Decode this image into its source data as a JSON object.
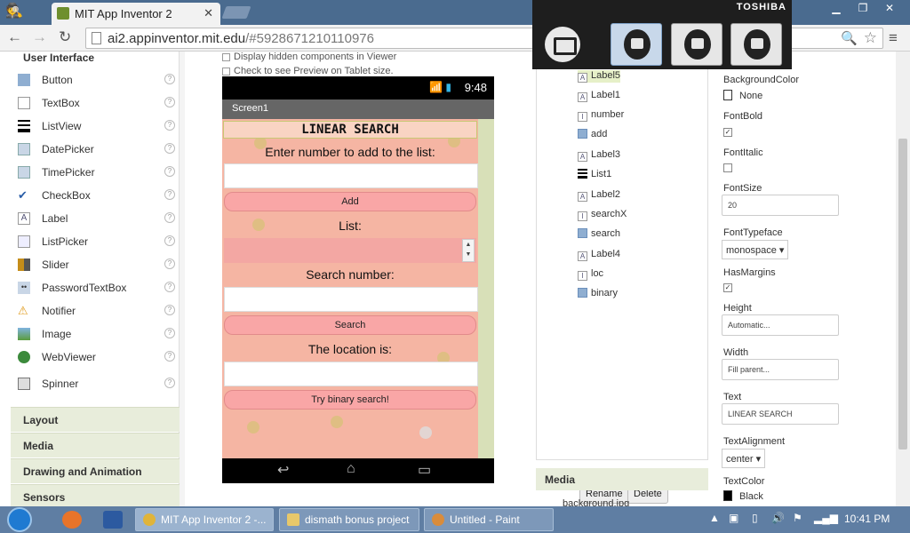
{
  "browser": {
    "tab_title": "MIT App Inventor 2",
    "url_host": "ai2.appinventor.mit.edu",
    "url_path": "/#5928671210110976"
  },
  "toshiba": {
    "brand": "TOSHIBA"
  },
  "palette": {
    "header": "User Interface",
    "items": [
      {
        "label": "Button",
        "icon": "button-icon"
      },
      {
        "label": "TextBox",
        "icon": "textbox-icon"
      },
      {
        "label": "ListView",
        "icon": "listview-icon"
      },
      {
        "label": "DatePicker",
        "icon": "datepicker-icon"
      },
      {
        "label": "TimePicker",
        "icon": "timepicker-icon"
      },
      {
        "label": "CheckBox",
        "icon": "checkbox-icon"
      },
      {
        "label": "Label",
        "icon": "label-icon"
      },
      {
        "label": "ListPicker",
        "icon": "listpicker-icon"
      },
      {
        "label": "Slider",
        "icon": "slider-icon"
      },
      {
        "label": "PasswordTextBox",
        "icon": "passwordtextbox-icon"
      },
      {
        "label": "Notifier",
        "icon": "notifier-icon"
      },
      {
        "label": "Image",
        "icon": "image-icon"
      },
      {
        "label": "WebViewer",
        "icon": "webviewer-icon"
      },
      {
        "label": "Spinner",
        "icon": "spinner-icon"
      }
    ],
    "drawers": [
      "Layout",
      "Media",
      "Drawing and Animation",
      "Sensors"
    ]
  },
  "viewer": {
    "check_hidden": "Display hidden components in Viewer",
    "check_tablet": "Check to see Preview on Tablet size.",
    "status_time": "9:48",
    "screen_title": "Screen1",
    "heading": "LINEAR SEARCH",
    "label_enter": "Enter number to add to the list:",
    "btn_add": "Add",
    "label_list": "List:",
    "label_search": "Search number:",
    "btn_search": "Search",
    "label_location": "The location is:",
    "btn_binary": "Try binary search!"
  },
  "components": {
    "items": [
      {
        "label": "Label5",
        "icon": "label-icon"
      },
      {
        "label": "Label1",
        "icon": "label-icon"
      },
      {
        "label": "number",
        "icon": "textbox-icon"
      },
      {
        "label": "add",
        "icon": "button-icon"
      },
      {
        "label": "Label3",
        "icon": "label-icon"
      },
      {
        "label": "List1",
        "icon": "listview-icon"
      },
      {
        "label": "Label2",
        "icon": "label-icon"
      },
      {
        "label": "searchX",
        "icon": "textbox-icon"
      },
      {
        "label": "search",
        "icon": "button-icon"
      },
      {
        "label": "Label4",
        "icon": "label-icon"
      },
      {
        "label": "loc",
        "icon": "textbox-icon"
      },
      {
        "label": "binary",
        "icon": "button-icon"
      }
    ],
    "rename": "Rename",
    "delete": "Delete",
    "media_header": "Media",
    "media_item": "background.jpg"
  },
  "properties": {
    "bgcolor_label": "BackgroundColor",
    "bgcolor_value": "None",
    "fontbold_label": "FontBold",
    "fontitalic_label": "FontItalic",
    "fontsize_label": "FontSize",
    "fontsize_value": "20",
    "fonttypeface_label": "FontTypeface",
    "fonttypeface_value": "monospace",
    "hasmargins_label": "HasMargins",
    "height_label": "Height",
    "height_value": "Automatic...",
    "width_label": "Width",
    "width_value": "Fill parent...",
    "text_label": "Text",
    "text_value": "LINEAR SEARCH",
    "textalign_label": "TextAlignment",
    "textalign_value": "center",
    "textcolor_label": "TextColor",
    "textcolor_value": "Black",
    "fontbold_checked": true,
    "fontitalic_checked": false,
    "hasmargins_checked": true
  },
  "taskbar": {
    "tasks": [
      "MIT App Inventor 2 -...",
      "dismath bonus project",
      "Untitled - Paint"
    ],
    "clock": "10:41 PM"
  }
}
